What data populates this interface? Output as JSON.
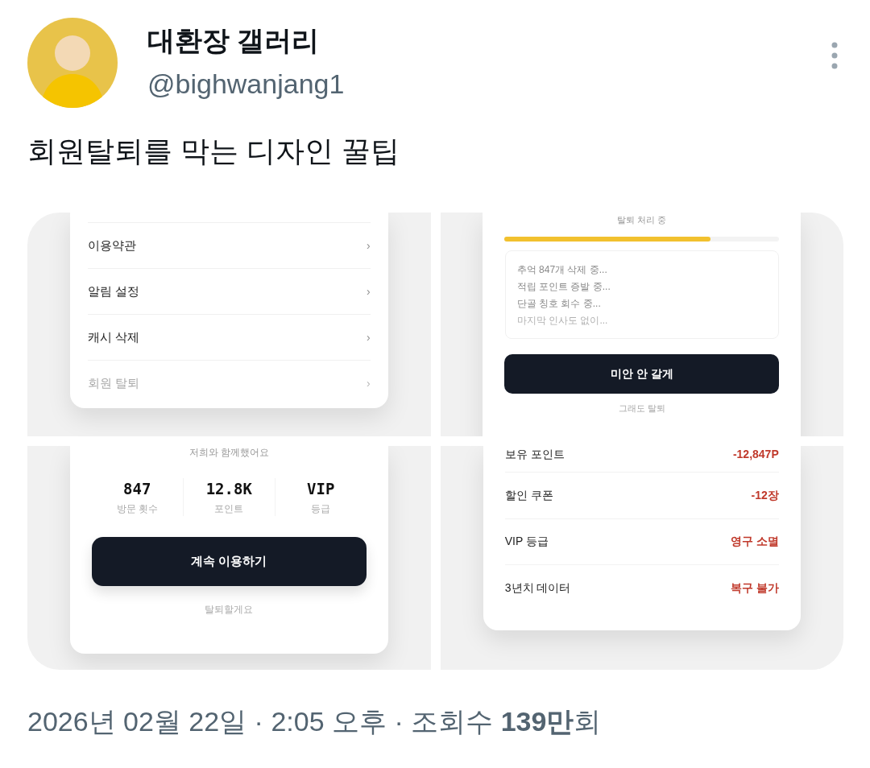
{
  "author": {
    "name": "대환장 갤러리",
    "handle": "@bighwanjang1"
  },
  "tweet_text": "회원탈퇴를 막는 디자인 꿀팁",
  "panels": [
    {
      "kind": "menu",
      "items": [
        {
          "label": "이용약관",
          "chevron": "›",
          "disabled": false
        },
        {
          "label": "알림 설정",
          "chevron": "›",
          "disabled": false
        },
        {
          "label": "캐시 삭제",
          "chevron": "›",
          "disabled": false
        },
        {
          "label": "회원 탈퇴",
          "chevron": "›",
          "disabled": true
        }
      ]
    },
    {
      "kind": "progress",
      "title": "탈퇴 처리 중",
      "level": 0.75,
      "log": [
        {
          "text": "추억 847개 삭제 중...",
          "faded": false
        },
        {
          "text": "적립 포인트 증발 중...",
          "faded": false
        },
        {
          "text": "단골 칭호 회수 중...",
          "faded": false
        },
        {
          "text": "마지막 인사도 없이...",
          "faded": true
        }
      ],
      "button": "미안 안 갈게",
      "link": "그래도 탈퇴"
    },
    {
      "kind": "stats",
      "subtitle": "저희와 함께했어요",
      "stats": [
        {
          "value": "847",
          "label": "방문 횟수"
        },
        {
          "value": "12.8K",
          "label": "포인트"
        },
        {
          "value": "VIP",
          "label": "등급"
        }
      ],
      "button": "계속 이용하기",
      "link": "탈퇴할게요"
    },
    {
      "kind": "losses",
      "rows": [
        {
          "label": "보유 포인트",
          "value": "-12,847P"
        },
        {
          "label": "할인 쿠폰",
          "value": "-12장"
        },
        {
          "label": "VIP 등급",
          "value": "영구 소멸"
        },
        {
          "label": "3년치 데이터",
          "value": "복구 불가"
        }
      ]
    }
  ],
  "footer": "2026년 02월 22일 · 2:05 오후 · 조회수 **139만**회"
}
